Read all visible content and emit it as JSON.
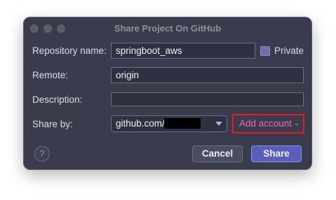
{
  "window": {
    "title": "Share Project On GitHub"
  },
  "form": {
    "repo_label": "Repository name:",
    "repo_value": "springboot_aws",
    "private_label": "Private",
    "private_checked": true,
    "remote_label": "Remote:",
    "remote_value": "origin",
    "description_label": "Description:",
    "description_value": "",
    "share_by_label": "Share by:",
    "share_by_value": "github.com/",
    "add_account_label": "Add account"
  },
  "buttons": {
    "help": "?",
    "cancel": "Cancel",
    "share": "Share"
  },
  "colors": {
    "dialog_bg": "#3a3c4e",
    "accent": "#5a5eb8",
    "highlight": "#e8192b",
    "add_account_text": "#e86ab3"
  }
}
